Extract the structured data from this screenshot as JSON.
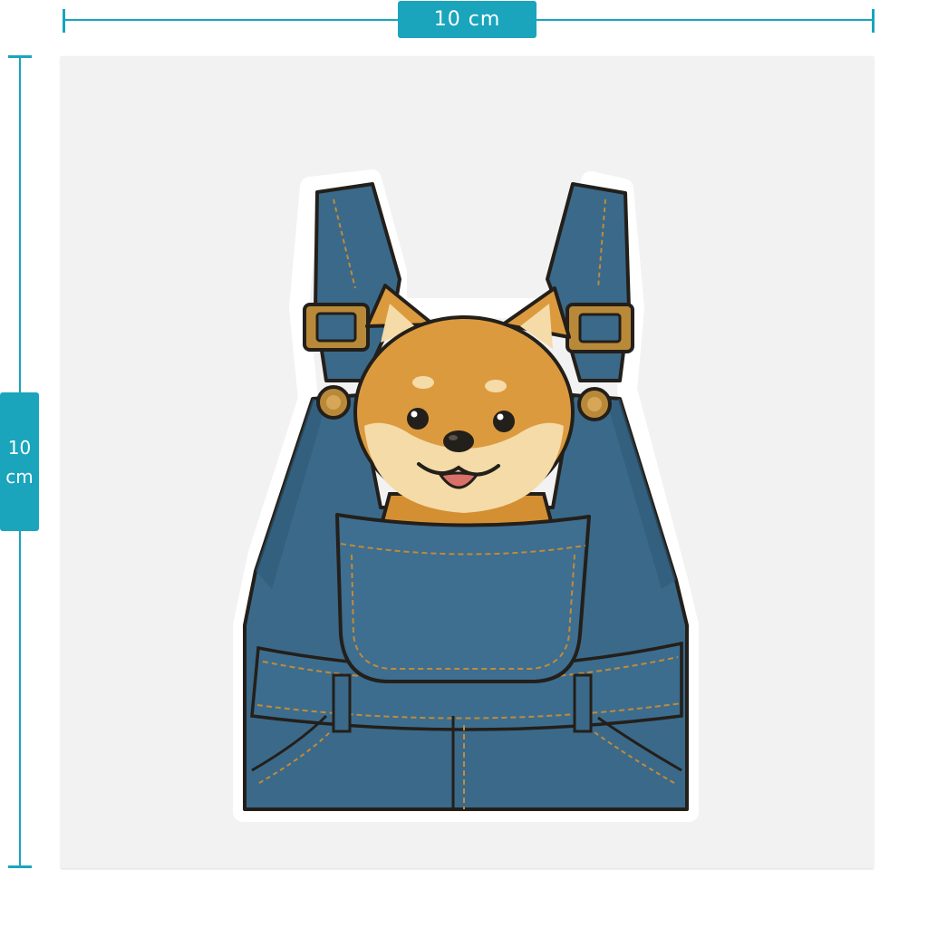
{
  "dimensions": {
    "width_label": "10 cm",
    "height_value": "10",
    "height_unit": "cm"
  },
  "colors": {
    "accent": "#1aa5bd",
    "sheet": "#f2f2f2",
    "denim": "#3b6989",
    "denim_dark": "#2f5a78",
    "stitch": "#c08b3a",
    "fur": "#dc9a3e",
    "fur_light": "#f4dba8",
    "outline": "#231f1a",
    "brass": "#b9893a"
  },
  "icons": [
    "shiba-inu-dog-icon",
    "denim-overalls-icon"
  ]
}
